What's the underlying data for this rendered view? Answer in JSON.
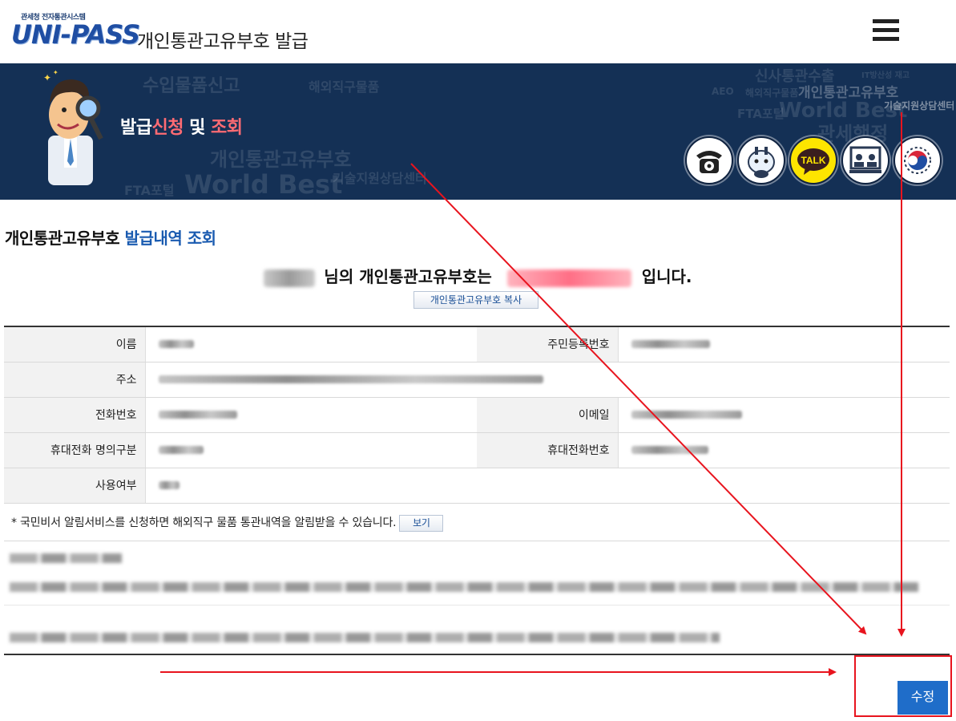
{
  "header": {
    "logo_small": "관세청 전자통관시스템",
    "logo_main": "UNI-PASS",
    "page_title": "개인통관고유부호  발급"
  },
  "banner": {
    "title_part1": "발급",
    "title_part2": "신청",
    "title_part3": " 및 ",
    "title_part4": "조회",
    "watermarks": [
      "수입물품신고",
      "해외직구물품",
      "개인통관고유부호",
      "World Best",
      "FTA포털",
      "기술지원상담센터",
      "관세행정",
      "신사통관수출",
      "IT방산성 재고",
      "AEO",
      "해외직구물품"
    ],
    "quick_icons": [
      "phone-icon",
      "mascot-robot-icon",
      "kakao-talk-icon",
      "remote-support-icon",
      "government-emblem-icon"
    ],
    "talk_label": "TALK"
  },
  "main": {
    "heading_black": "개인통관고유부호 ",
    "heading_blue": "발급내역 조회",
    "result_mid": " 님의 개인통관고유부호는 ",
    "result_end": " 입니다.",
    "copy_button": "개인통관고유부호 복사"
  },
  "table": {
    "rows": [
      {
        "label1": "이름",
        "label2": "주민등록번호"
      },
      {
        "label1": "주소"
      },
      {
        "label1": "전화번호",
        "label2": "이메일"
      },
      {
        "label1": "휴대전화 명의구분",
        "label2": "휴대전화번호"
      },
      {
        "label1": "사용여부"
      }
    ]
  },
  "notice": {
    "text": "* 국민비서 알림서비스를 신청하면 해외직구 물품 통관내역을 알림받을 수 있습니다.",
    "view_button": "보기"
  },
  "actions": {
    "edit_button": "수정"
  },
  "colors": {
    "banner_bg": "#143055",
    "accent_pink": "#ff6b73",
    "heading_blue": "#1a5bb0",
    "edit_button_bg": "#1f6dc9",
    "annotation_red": "#e8141e"
  }
}
